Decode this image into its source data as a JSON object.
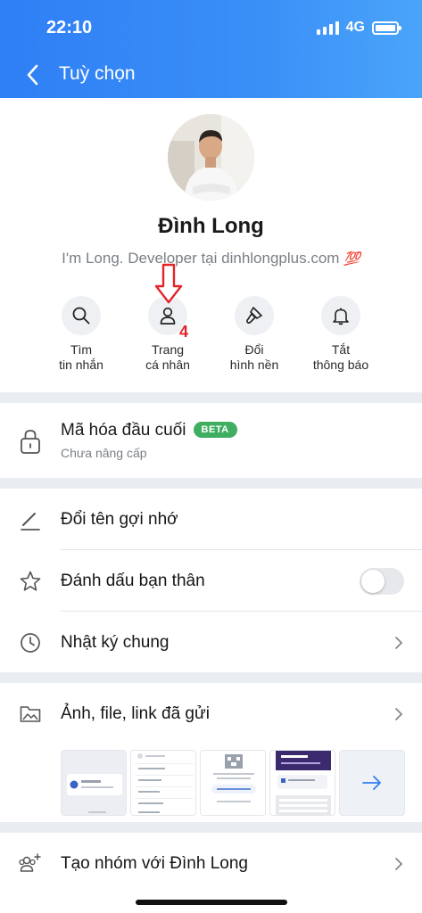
{
  "status_bar": {
    "time": "22:10",
    "network": "4G"
  },
  "header": {
    "title": "Tuỳ chọn",
    "back_icon": "chevron-left-icon"
  },
  "profile": {
    "name": "Đình Long",
    "bio": "I'm Long. Developer tại dinhlongplus.com",
    "bio_emoji": "💯"
  },
  "actions": [
    {
      "line1": "Tìm",
      "line2": "tin nhắn",
      "icon": "search-icon"
    },
    {
      "line1": "Trang",
      "line2": "cá nhân",
      "icon": "user-icon"
    },
    {
      "line1": "Đổi",
      "line2": "hình nền",
      "icon": "paint-brush-icon"
    },
    {
      "line1": "Tắt",
      "line2": "thông báo",
      "icon": "bell-icon"
    }
  ],
  "annotation": {
    "number": "4"
  },
  "encryption": {
    "title": "Mã hóa đầu cuối",
    "badge": "BETA",
    "subtitle": "Chưa nâng cấp"
  },
  "menu": {
    "rename": "Đổi tên gợi nhớ",
    "best_friend": "Đánh dấu bạn thân",
    "best_friend_on": false,
    "journal": "Nhật ký chung",
    "media": "Ảnh, file, link đã gửi",
    "create_group": "Tạo nhóm với Đình Long"
  },
  "colors": {
    "header": "#3a8ff7",
    "beta": "#3fae61",
    "annotation": "#e0262c"
  }
}
